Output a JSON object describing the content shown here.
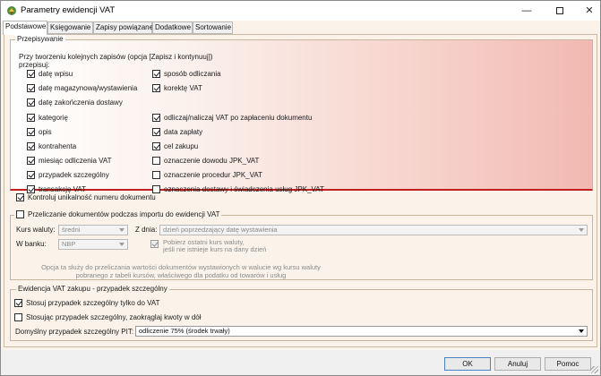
{
  "window": {
    "title": "Parametry ewidencji VAT",
    "minimize_glyph": "—",
    "close_glyph": "✕"
  },
  "tabs": [
    {
      "label": "Podstawowe",
      "active": true
    },
    {
      "label": "Księgowanie",
      "active": false
    },
    {
      "label": "Zapisy powiązane",
      "active": false
    },
    {
      "label": "Dodatkowe",
      "active": false
    },
    {
      "label": "Sortowanie",
      "active": false
    }
  ],
  "przepisywanie": {
    "caption": "Przepisywanie",
    "intro": "Przy tworzeniu kolejnych zapisów (opcja [Zapisz i kontynuuj]) przepisuj:",
    "left": [
      {
        "label": "datę wpisu",
        "checked": true
      },
      {
        "label": "datę magazynową/wystawienia",
        "checked": true
      },
      {
        "label": "datę zakończenia dostawy",
        "checked": true
      },
      {
        "label": "kategorię",
        "checked": true
      },
      {
        "label": "opis",
        "checked": true
      },
      {
        "label": "kontrahenta",
        "checked": true
      },
      {
        "label": "miesiąc odliczenia VAT",
        "checked": true
      },
      {
        "label": "przypadek szczególny",
        "checked": true
      },
      {
        "label": "transakcję VAT",
        "checked": true
      }
    ],
    "right": [
      {
        "label": "sposób odliczania",
        "checked": true
      },
      {
        "label": "korektę VAT",
        "checked": true
      },
      {
        "label": "odliczaj/naliczaj VAT po zapłaceniu dokumentu",
        "checked": true
      },
      {
        "label": "data zapłaty",
        "checked": true
      },
      {
        "label": "cel zakupu",
        "checked": true
      },
      {
        "label": "oznaczenie dowodu JPK_VAT",
        "checked": false
      },
      {
        "label": "oznaczenie procedur JPK_VAT",
        "checked": false
      },
      {
        "label": "oznaczenia dostawy i świadczenia usług JPK_VAT",
        "checked": false
      }
    ]
  },
  "kontroluj": {
    "label": "Kontroluj unikalność numeru dokumentu",
    "checked": true
  },
  "przeliczanie": {
    "caption": "Przeliczanie dokumentów podczas importu do ewidencji VAT",
    "checked": false,
    "kurs_label": "Kurs waluty:",
    "kurs_value": "średni",
    "z_dnia_label": "Z dnia:",
    "z_dnia_value": "dzień poprzedzający datę wystawienia",
    "w_banku_label": "W banku:",
    "w_banku_value": "NBP",
    "pobierz_line1": "Pobierz ostatni kurs waluty,",
    "pobierz_line2": "jeśli nie istnieje kurs na dany dzień",
    "pobierz_checked": true,
    "note": "Opcja ta służy do przeliczania wartości dokumentów wystawionych w walucie wg kursu waluty pobranego z tabeli kursów, właściwego dla podatku od towarów i usług"
  },
  "ewidencja": {
    "caption": "Ewidencja VAT zakupu - przypadek szczególny",
    "opt1": {
      "label": "Stosuj przypadek szczególny tylko do VAT",
      "checked": true
    },
    "opt2": {
      "label": "Stosując przypadek szczególny, zaokrąglaj kwoty w dół",
      "checked": false
    },
    "pit_label": "Domyślny przypadek szczególny PIT:",
    "pit_value": "odliczenie 75% (środek trwały)"
  },
  "buttons": {
    "ok": "OK",
    "anuluj": "Anuluj",
    "pomoc": "Pomoc"
  },
  "colors": {
    "accent_line": "#c0201f",
    "default_button_border": "#4a7fc4"
  }
}
